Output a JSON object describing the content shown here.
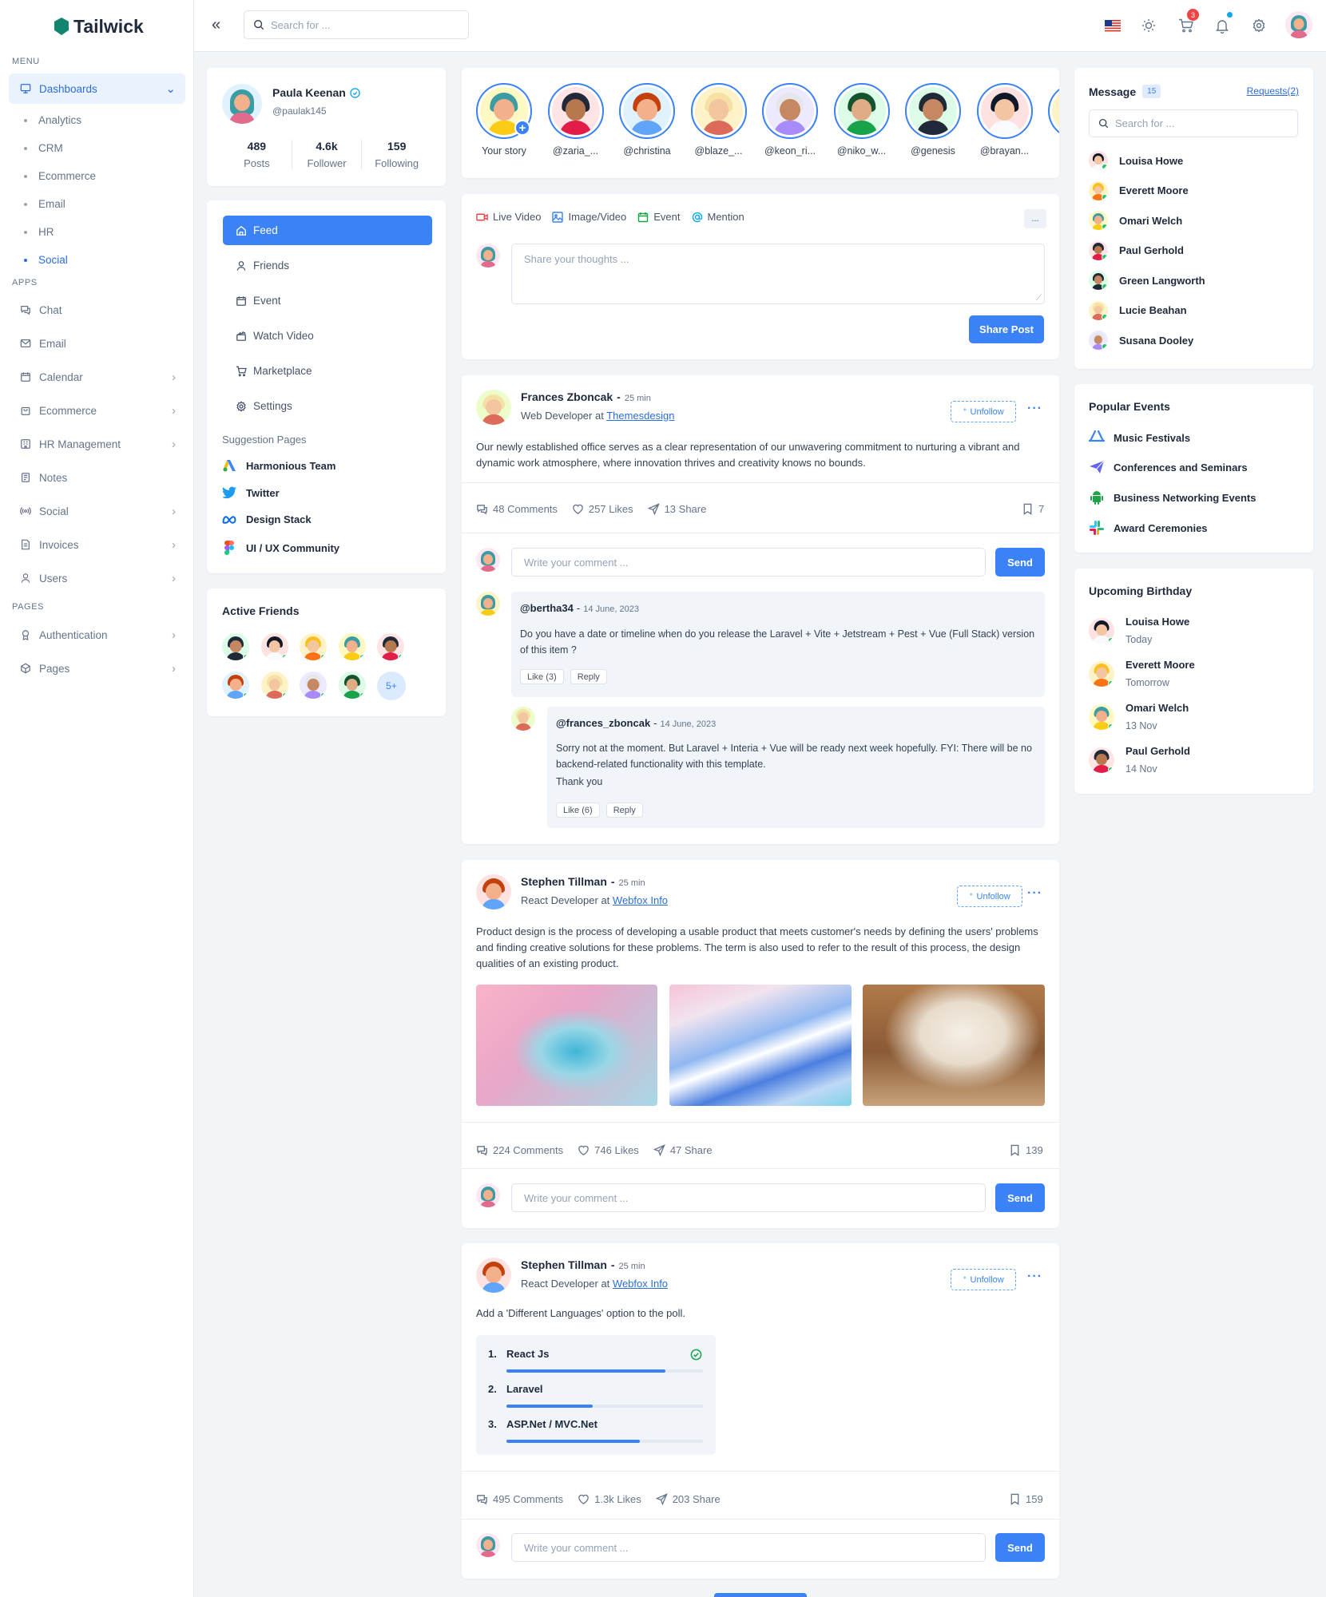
{
  "app": {
    "brand": "Tailwick"
  },
  "sidebar": {
    "menu_heading": "MENU",
    "dashboards_label": "Dashboards",
    "sub_items": [
      "Analytics",
      "CRM",
      "Ecommerce",
      "Email",
      "HR",
      "Social"
    ],
    "apps_heading": "APPS",
    "apps": [
      "Chat",
      "Email",
      "Calendar",
      "Ecommerce",
      "HR Management",
      "Notes",
      "Social",
      "Invoices",
      "Users"
    ],
    "pages_heading": "PAGES",
    "pages": [
      "Authentication",
      "Pages"
    ]
  },
  "topbar": {
    "search_placeholder": "Search for ...",
    "cart_count": "3",
    "collapse_glyph": "«"
  },
  "profile": {
    "name": "Paula Keenan",
    "handle": "@paulak145",
    "stats": [
      {
        "value": "489",
        "label": "Posts"
      },
      {
        "value": "4.6k",
        "label": "Follower"
      },
      {
        "value": "159",
        "label": "Following"
      }
    ]
  },
  "nav": {
    "items": [
      "Feed",
      "Friends",
      "Event",
      "Watch Video",
      "Marketplace",
      "Settings"
    ],
    "suggestion_heading": "Suggestion Pages",
    "suggestions": [
      "Harmonious Team",
      "Twitter",
      "Design Stack",
      "UI / UX Community"
    ]
  },
  "active_friends": {
    "heading": "Active Friends",
    "more": "5+"
  },
  "stories": {
    "items": [
      "Your story",
      "@zaria_...",
      "@christina",
      "@blaze_...",
      "@keon_ri...",
      "@niko_w...",
      "@genesis",
      "@brayan...",
      "@"
    ]
  },
  "composer": {
    "tabs": [
      "Live Video",
      "Image/Video",
      "Event",
      "Mention"
    ],
    "more": "...",
    "placeholder": "Share your thoughts ...",
    "button": "Share Post"
  },
  "post1": {
    "author": "Frances Zboncak",
    "time": "25 min",
    "role_prefix": "Web Developer at",
    "role_link": "Themesdesign",
    "unfollow": "Unfollow",
    "body": "Our newly established office serves as a clear representation of our unwavering commitment to nurturing a vibrant and dynamic work atmosphere, where innovation thrives and creativity knows no bounds.",
    "comments": "48 Comments",
    "likes": "257 Likes",
    "shares": "13 Share",
    "saves": "7",
    "comment_placeholder": "Write your comment ...",
    "send": "Send",
    "thread": {
      "author": "@bertha34",
      "date": "14 June, 2023",
      "text": "Do you have a date or timeline when do you release the Laravel + Vite + Jetstream + Pest + Vue (Full Stack) version of this item ?",
      "like": "Like (3)",
      "reply": "Reply",
      "reply_author": "@frances_zboncak",
      "reply_date": "14 June, 2023",
      "reply_text": "Sorry not at the moment. But Laravel + Interia + Vue will be ready next week hopefully. FYI: There will be no backend-related functionality with this template.",
      "reply_thanks": "Thank you",
      "reply_like": "Like (6)",
      "reply_reply": "Reply"
    }
  },
  "post2": {
    "author": "Stephen Tillman",
    "time": "25 min",
    "role_prefix": "React Developer at",
    "role_link": "Webfox Info",
    "unfollow": "Unfollow",
    "body": "Product design is the process of developing a usable product that meets customer's needs by defining the users' problems and finding creative solutions for these problems. The term is also used to refer to the result of this process, the design qualities of an existing product.",
    "comments": "224 Comments",
    "likes": "746 Likes",
    "shares": "47 Share",
    "saves": "139",
    "comment_placeholder": "Write your comment ...",
    "send": "Send"
  },
  "post3": {
    "author": "Stephen Tillman",
    "time": "25 min",
    "role_prefix": "React Developer at",
    "role_link": "Webfox Info",
    "unfollow": "Unfollow",
    "body": "Add a 'Different Languages' option to the poll.",
    "poll": [
      {
        "num": "1.",
        "label": "React Js",
        "fill": 0.81
      },
      {
        "num": "2.",
        "label": "Laravel",
        "fill": 0.44
      },
      {
        "num": "3.",
        "label": "ASP.Net / MVC.Net",
        "fill": 0.68
      }
    ],
    "comments": "495 Comments",
    "likes": "1.3k Likes",
    "shares": "203 Share",
    "saves": "159",
    "comment_placeholder": "Write your comment ...",
    "send": "Send"
  },
  "messages": {
    "heading": "Message",
    "count": "15",
    "requests": "Requests(2)",
    "search_placeholder": "Search for ...",
    "people": [
      "Louisa Howe",
      "Everett Moore",
      "Omari Welch",
      "Paul Gerhold",
      "Green Langworth",
      "Lucie Beahan",
      "Susana Dooley"
    ]
  },
  "events": {
    "heading": "Popular Events",
    "items": [
      "Music Festivals",
      "Conferences and Seminars",
      "Business Networking Events",
      "Award Ceremonies"
    ]
  },
  "birthdays": {
    "heading": "Upcoming Birthday",
    "items": [
      {
        "name": "Louisa Howe",
        "when": "Today"
      },
      {
        "name": "Everett Moore",
        "when": "Tomorrow"
      },
      {
        "name": "Omari Welch",
        "when": "13 Nov"
      },
      {
        "name": "Paul Gerhold",
        "when": "14 Nov"
      }
    ]
  }
}
